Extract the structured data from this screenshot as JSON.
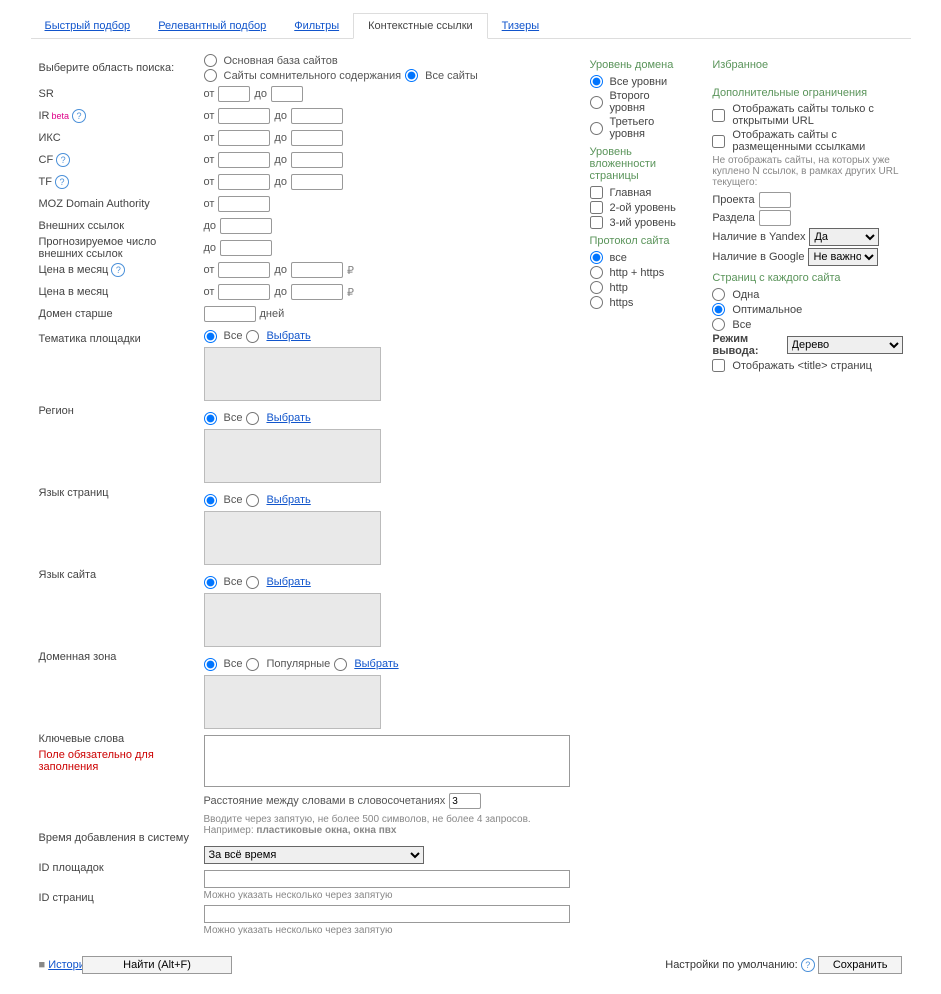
{
  "tabs": [
    "Быстрый подбор",
    "Релевантный подбор",
    "Фильтры",
    "Контекстные ссылки",
    "Тизеры"
  ],
  "active_tab": "Контекстные ссылки",
  "left": {
    "search_area": "Выберите область поиска:",
    "sr": "SR",
    "ir": "IR",
    "ir_badge": "beta",
    "iks": "ИКС",
    "cf": "CF",
    "tf": "TF",
    "moz": "MOZ Domain Authority",
    "ext_links": "Внешних ссылок",
    "predicted": "Прогнозируемое число внешних ссылок",
    "price_month_q": "Цена в месяц",
    "price_month": "Цена в месяц",
    "domain_older": "Домен старше",
    "theme": "Тематика площадки",
    "region": "Регион",
    "page_lang": "Язык страниц",
    "site_lang": "Язык сайта",
    "domain_zone": "Доменная зона",
    "keywords": "Ключевые слова",
    "keywords_req": "Поле обязательно для заполнения",
    "added_time": "Время добавления в систему",
    "site_ids": "ID площадок",
    "page_ids": "ID страниц"
  },
  "mid": {
    "base_opt1": "Основная база сайтов",
    "base_opt2": "Сайты сомнительного содержания",
    "base_opt3": "Все сайты",
    "from": "от",
    "to": "до",
    "rub": "₽",
    "days": "дней",
    "all": "Все",
    "choose": "Выбрать",
    "popular": "Популярные",
    "dist_label": "Расстояние между словами в словосочетаниях",
    "dist_val": "3",
    "keywords_hint": "Вводите через запятую, не более 500 символов, не более 4 запросов. Например: ",
    "keywords_example": "пластиковые окна, окна пвх",
    "time_sel": "За всё время",
    "ids_hint": "Можно указать несколько через запятую",
    "find_btn": "Найти (Alt+F)"
  },
  "right": {
    "domain_level": {
      "title": "Уровень домена",
      "o1": "Все уровни",
      "o2": "Второго уровня",
      "o3": "Третьего уровня"
    },
    "page_nesting": {
      "title": "Уровень вложенности страницы",
      "o1": "Главная",
      "o2": "2-ой уровень",
      "o3": "3-ий уровень"
    },
    "protocol": {
      "title": "Протокол сайта",
      "o1": "все",
      "o2": "http + https",
      "o3": "http",
      "o4": "https"
    },
    "favorites": "Избранное",
    "extra": {
      "title": "Дополнительные ограничения",
      "c1": "Отображать сайты только с открытыми URL",
      "c2": "Отображать сайты с размещенными ссылками",
      "note": "Не отображать сайты, на которых уже куплено N ссылок, в рамках других URL текущего:",
      "project": "Проекта",
      "section": "Раздела",
      "yandex": "Наличие в Yandex",
      "yandex_val": "Да",
      "google": "Наличие в Google",
      "google_val": "Не важно"
    },
    "per_site": {
      "title": "Страниц с каждого сайта",
      "o1": "Одна",
      "o2": "Оптимальное",
      "o3": "Все"
    },
    "output_mode": "Режим вывода:",
    "output_val": "Дерево",
    "show_title": "Отображать <title> страниц"
  },
  "footer": {
    "history": "История поиска",
    "defaults": "Настройки по умолчанию:",
    "save": "Сохранить"
  }
}
